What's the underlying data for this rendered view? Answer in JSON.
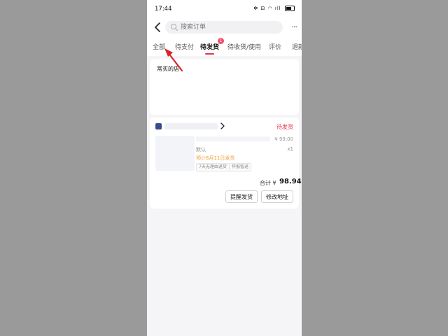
{
  "status_bar": {
    "time": "17:44",
    "icons_text": "✻ ⊟ ◠ ıll"
  },
  "header": {
    "search_placeholder": "搜索订单",
    "more_label": "···"
  },
  "tabs": [
    {
      "label": "全部",
      "active": false
    },
    {
      "label": "待支付",
      "active": false
    },
    {
      "label": "待发货",
      "active": true,
      "badge": "1"
    },
    {
      "label": "待收货/使用",
      "active": false
    },
    {
      "label": "评价",
      "active": false
    },
    {
      "label": "退款",
      "active": false
    }
  ],
  "favorites": {
    "title": "常买的店"
  },
  "order": {
    "status": "待发货",
    "price": "¥ 99.00",
    "variant": "默认",
    "quantity": "x1",
    "ship_note": "预计6月11日发货",
    "tags": [
      "7天无理由退货",
      "怀报智退"
    ],
    "total_label": "合计 ¥",
    "total_value": "98.94",
    "buttons": {
      "remind": "提醒发货",
      "change_address": "修改地址"
    }
  },
  "colors": {
    "accent": "#e8344e",
    "ship_note": "#e9a33a",
    "shop_logo": "#3b4a8c"
  }
}
